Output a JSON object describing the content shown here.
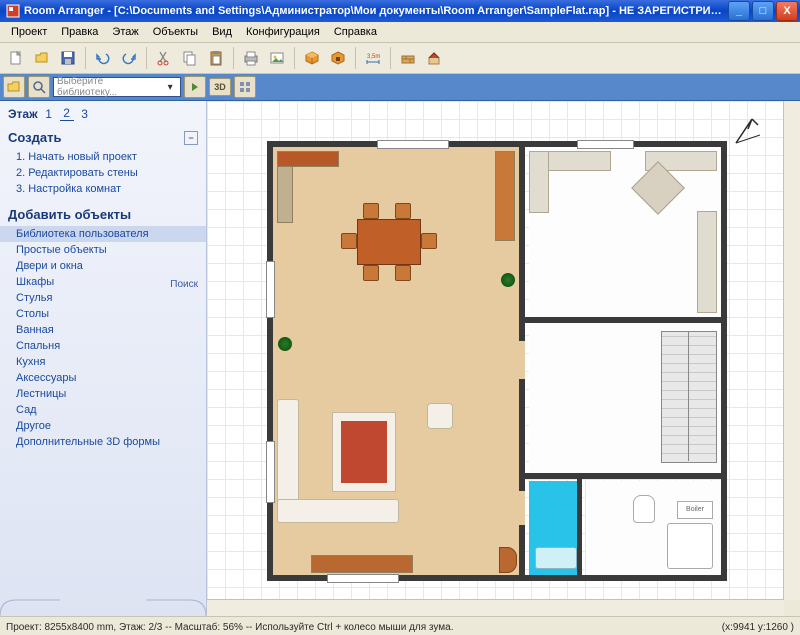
{
  "title": "Room Arranger - [C:\\Documents and Settings\\Администратор\\Мои документы\\Room Arranger\\SampleFlat.rap] - НЕ ЗАРЕГИСТРИРО...",
  "menu": [
    "Проект",
    "Правка",
    "Этаж",
    "Объекты",
    "Вид",
    "Конфигурация",
    "Справка"
  ],
  "lib_placeholder": "Выберите библиотеку...",
  "badge3d": "3D",
  "floor": {
    "label": "Этаж",
    "items": [
      "1",
      "2",
      "3"
    ],
    "active": 1
  },
  "create": {
    "label": "Создать",
    "items": [
      "1. Начать новый проект",
      "2. Редактировать стены",
      "3. Настройка комнат"
    ]
  },
  "addobj": {
    "label": "Добавить объекты",
    "search": "Поиск",
    "items": [
      "Библиотека пользователя",
      "Простые объекты",
      "Двери и окна",
      "Шкафы",
      "Стулья",
      "Столы",
      "Ванная",
      "Спальня",
      "Кухня",
      "Аксессуары",
      "Лестницы",
      "Сад",
      "Другое",
      "Дополнительные 3D формы"
    ]
  },
  "boiler_label": "Boiler",
  "status_left": "Проект: 8255x8400 mm, Этаж: 2/3 -- Масштаб: 56% -- Используйте Ctrl + колесо мыши для зума.",
  "status_right": "(x:9941 y:1260 )"
}
